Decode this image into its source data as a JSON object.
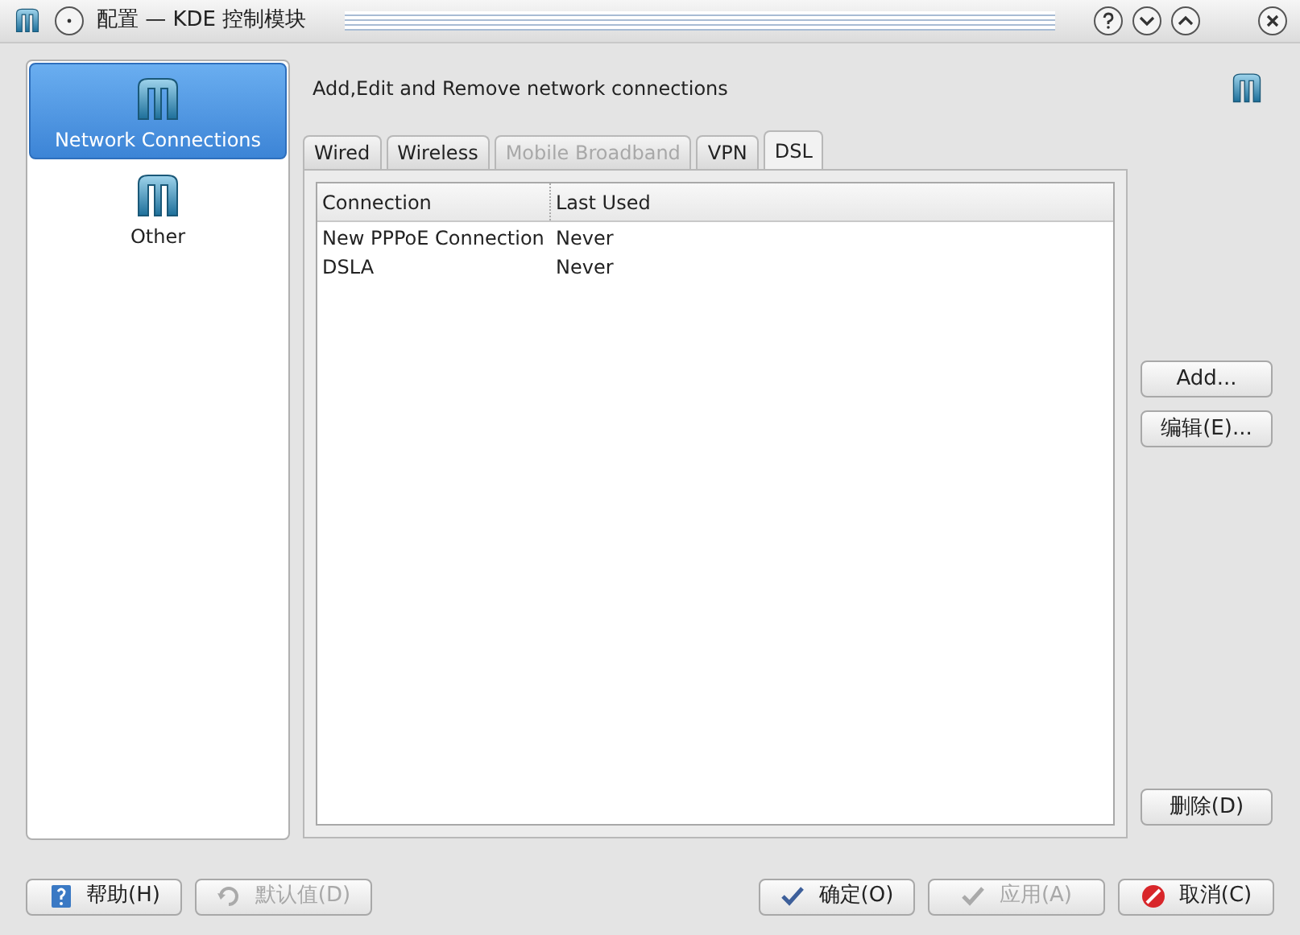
{
  "window": {
    "title": "配置 — KDE 控制模块"
  },
  "sidebar": {
    "items": [
      {
        "label": "Network Connections",
        "selected": true
      },
      {
        "label": "Other",
        "selected": false
      }
    ]
  },
  "header": "Add,Edit and Remove network connections",
  "tabs": [
    {
      "label": "Wired",
      "selected": false,
      "disabled": false
    },
    {
      "label": "Wireless",
      "selected": false,
      "disabled": false
    },
    {
      "label": "Mobile Broadband",
      "selected": false,
      "disabled": true
    },
    {
      "label": "VPN",
      "selected": false,
      "disabled": false
    },
    {
      "label": "DSL",
      "selected": true,
      "disabled": false
    }
  ],
  "table": {
    "columns": [
      "Connection",
      "Last Used"
    ],
    "rows": [
      [
        "New PPPoE Connection",
        "Never"
      ],
      [
        "DSLA",
        "Never"
      ]
    ]
  },
  "side_buttons": [
    {
      "label": "Add..."
    },
    {
      "label": "编辑(E)..."
    },
    {
      "label": "删除(D)"
    }
  ],
  "footer_buttons": [
    {
      "label": "帮助(H)",
      "kind": "help",
      "disabled": false
    },
    {
      "label": "默认值(D)",
      "kind": "defaults",
      "disabled": true
    },
    {
      "label": "确定(O)",
      "kind": "ok",
      "disabled": false
    },
    {
      "label": "应用(A)",
      "kind": "apply",
      "disabled": true
    },
    {
      "label": "取消(C)",
      "kind": "cancel",
      "disabled": false
    }
  ]
}
